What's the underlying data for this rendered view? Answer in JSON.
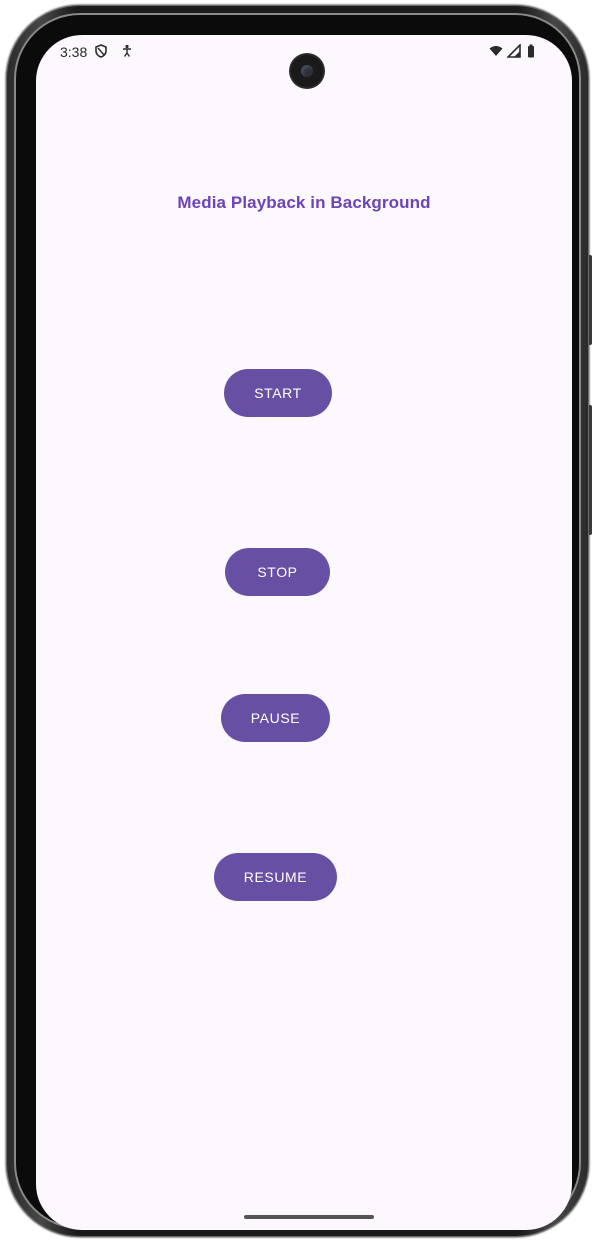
{
  "status_bar": {
    "time": "3:38"
  },
  "app": {
    "title": "Media Playback in Background"
  },
  "buttons": {
    "start": "START",
    "stop": "STOP",
    "pause": "PAUSE",
    "resume": "RESUME"
  },
  "colors": {
    "button": "#6750a4",
    "title": "#6b45b6",
    "background": "#fdf7fe"
  }
}
